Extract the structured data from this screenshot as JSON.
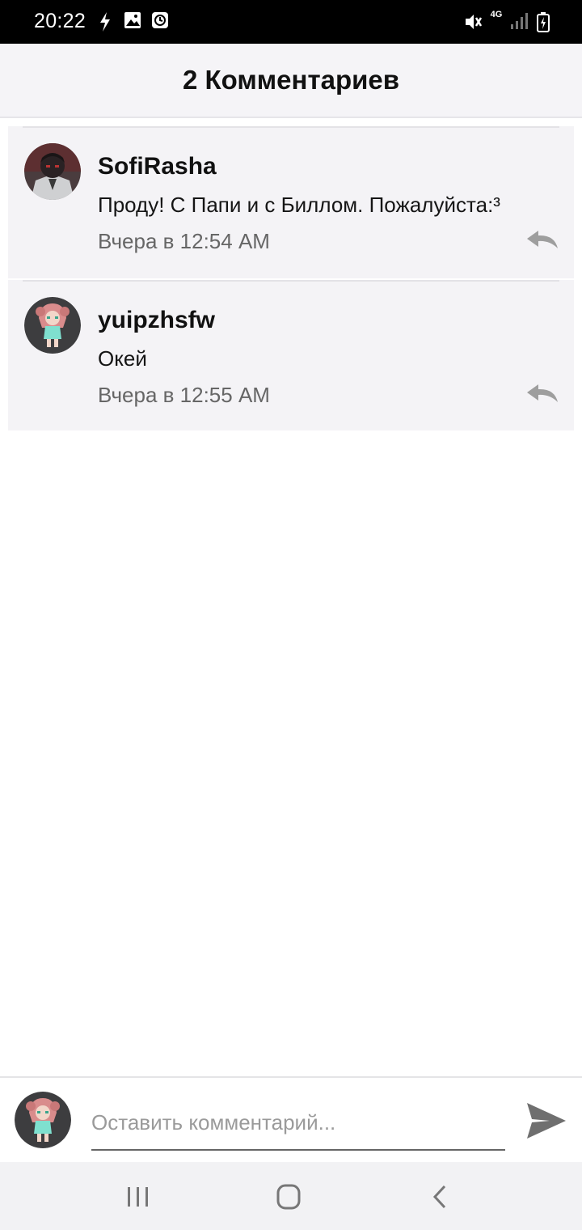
{
  "status_bar": {
    "time": "20:22",
    "network_type": "4G",
    "icons": [
      "flash-icon",
      "image-icon",
      "clock-icon",
      "mute-icon",
      "signal-icon",
      "battery-icon"
    ]
  },
  "header": {
    "title": "2 Комментариев"
  },
  "comments": [
    {
      "username": "SofiRasha",
      "text": "Проду! С Папи и с Биллом. Пожалуйста:³",
      "timestamp": "Вчера в 12:54 AM",
      "avatar_icon": "user-avatar-icon",
      "reply_icon": "reply-icon"
    },
    {
      "username": "yuipzhsfw",
      "text": "Окей",
      "timestamp": "Вчера в 12:55 AM",
      "avatar_icon": "user-avatar-icon",
      "reply_icon": "reply-icon"
    }
  ],
  "input_bar": {
    "placeholder": "Оставить комментарий...",
    "value": "",
    "send_icon": "send-icon"
  },
  "nav_bar": {
    "icons": [
      "recents-icon",
      "home-icon",
      "back-icon"
    ]
  },
  "colors": {
    "status_bar_bg": "#000000",
    "header_bg": "#f5f4f7",
    "comment_bg": "#f4f3f6",
    "timestamp_text": "#666666",
    "reply_icon": "#9e9e9e",
    "send_icon": "#6f6f6f",
    "nav_bar_bg": "#f2f2f4"
  }
}
